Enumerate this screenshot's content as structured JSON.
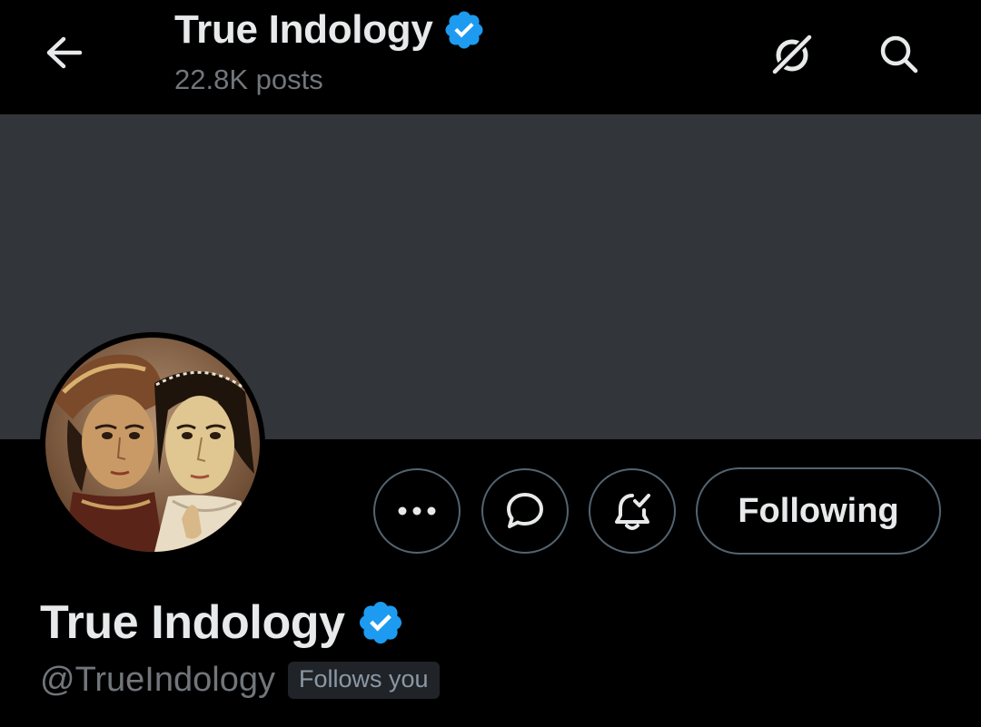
{
  "header": {
    "title": "True Indology",
    "posts_count": "22.8K posts"
  },
  "icons": {
    "back": "arrow-left-icon",
    "verified": "verified-badge-icon",
    "grok": "grok-icon",
    "search": "search-icon",
    "more": "more-horizontal-icon",
    "message": "message-icon",
    "notifications": "bell-check-icon"
  },
  "profile": {
    "name": "True Indology",
    "handle": "@TrueIndology",
    "follows_you_label": "Follows you"
  },
  "actions": {
    "following_label": "Following"
  },
  "colors": {
    "background": "#000000",
    "banner": "#323539",
    "verified_blue": "#1d9bf0",
    "secondary_text": "#71767b",
    "button_border": "#536471"
  }
}
